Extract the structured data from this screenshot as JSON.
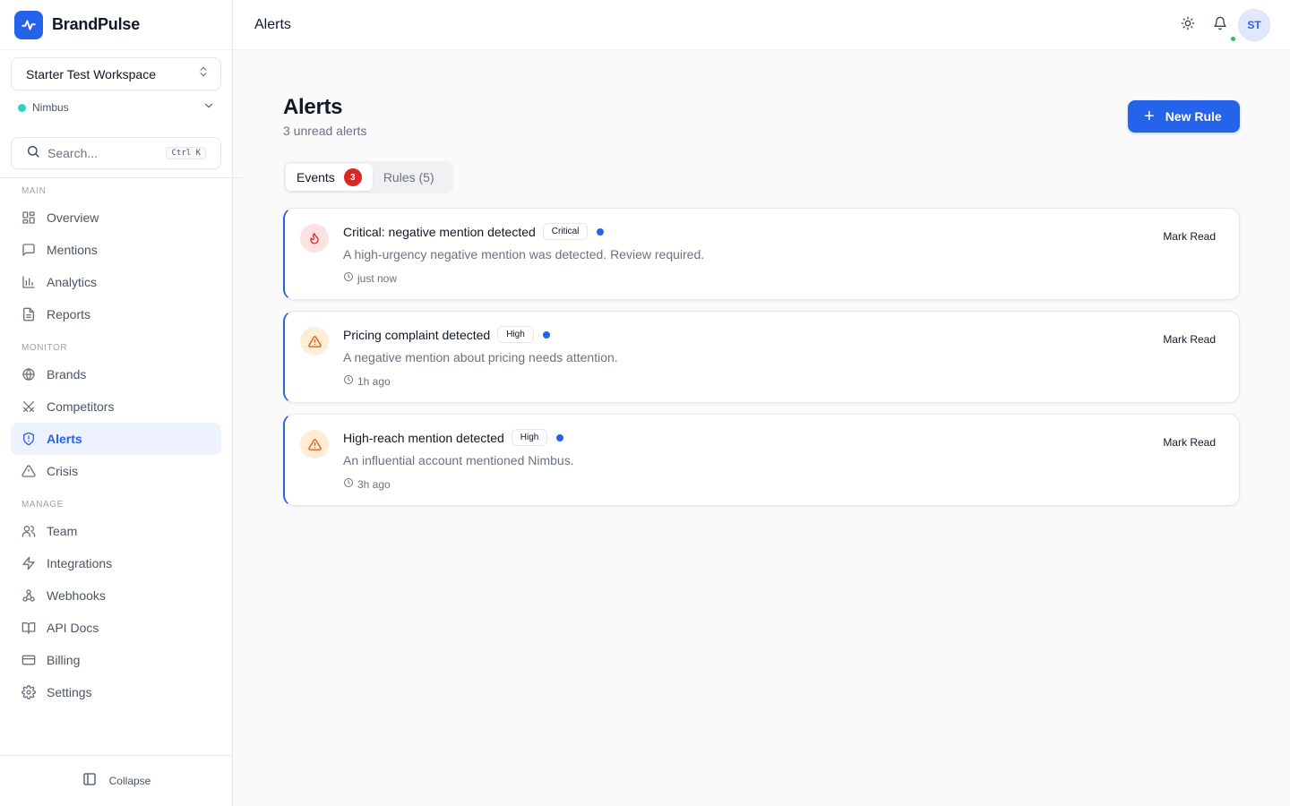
{
  "app": {
    "name": "BrandPulse"
  },
  "sidebar": {
    "workspace": "Starter Test Workspace",
    "brand": "Nimbus",
    "search": {
      "placeholder": "Search...",
      "shortcut": "Ctrl K"
    },
    "sections": {
      "main": "MAIN",
      "monitor": "MONITOR",
      "manage": "MANAGE"
    },
    "items": {
      "overview": "Overview",
      "mentions": "Mentions",
      "analytics": "Analytics",
      "reports": "Reports",
      "brands": "Brands",
      "competitors": "Competitors",
      "alerts": "Alerts",
      "crisis": "Crisis",
      "team": "Team",
      "integrations": "Integrations",
      "webhooks": "Webhooks",
      "api_docs": "API Docs",
      "billing": "Billing",
      "settings": "Settings"
    },
    "active_item": "alerts",
    "collapse_label": "Collapse"
  },
  "header": {
    "title": "Alerts",
    "user_initials": "ST"
  },
  "page": {
    "title": "Alerts",
    "subtitle": "3 unread alerts",
    "new_rule_label": "New Rule",
    "tabs": {
      "events": {
        "label": "Events",
        "count": "3"
      },
      "rules": {
        "label": "Rules (5)"
      }
    }
  },
  "alerts": [
    {
      "title": "Critical: negative mention detected",
      "severity": "Critical",
      "description": "A high-urgency negative mention was detected. Review required.",
      "time": "just now",
      "action": "Mark Read",
      "icon": "flame-icon"
    },
    {
      "title": "Pricing complaint detected",
      "severity": "High",
      "description": "A negative mention about pricing needs attention.",
      "time": "1h ago",
      "action": "Mark Read",
      "icon": "warning-triangle-icon"
    },
    {
      "title": "High-reach mention detected",
      "severity": "High",
      "description": "An influential account mentioned Nimbus.",
      "time": "3h ago",
      "action": "Mark Read",
      "icon": "warning-triangle-icon"
    }
  ],
  "colors": {
    "accent": "#2563eb",
    "critical_bg": "#fee2e2",
    "critical_icon": "#dc2626",
    "high_bg": "#ffedd5",
    "high_icon": "#ea580c",
    "online": "#22c55e",
    "brand_dot": "#2dd4bf"
  }
}
